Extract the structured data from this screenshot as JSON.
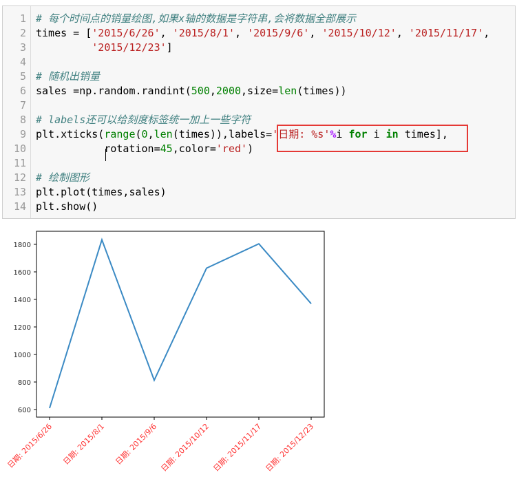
{
  "notebook": {
    "lines": [
      {
        "n": "1",
        "tokens": [
          {
            "t": "# 每个时间点的销量绘图,如果x轴的数据是字符串,会将数据全部展示",
            "c": "comment"
          }
        ]
      },
      {
        "n": "2",
        "tokens": [
          {
            "t": "times = [",
            "c": ""
          },
          {
            "t": "'2015/6/26'",
            "c": "str"
          },
          {
            "t": ", ",
            "c": ""
          },
          {
            "t": "'2015/8/1'",
            "c": "str"
          },
          {
            "t": ", ",
            "c": ""
          },
          {
            "t": "'2015/9/6'",
            "c": "str"
          },
          {
            "t": ", ",
            "c": ""
          },
          {
            "t": "'2015/10/12'",
            "c": "str"
          },
          {
            "t": ", ",
            "c": ""
          },
          {
            "t": "'2015/11/17'",
            "c": "str"
          },
          {
            "t": ",",
            "c": ""
          }
        ]
      },
      {
        "n": "3",
        "tokens": [
          {
            "t": "         ",
            "c": ""
          },
          {
            "t": "'2015/12/23'",
            "c": "str"
          },
          {
            "t": "]",
            "c": ""
          }
        ]
      },
      {
        "n": "4",
        "tokens": []
      },
      {
        "n": "5",
        "tokens": [
          {
            "t": "# 随机出销量",
            "c": "comment"
          }
        ]
      },
      {
        "n": "6",
        "tokens": [
          {
            "t": "sales =np.random.randint(",
            "c": ""
          },
          {
            "t": "500",
            "c": "num"
          },
          {
            "t": ",",
            "c": ""
          },
          {
            "t": "2000",
            "c": "num"
          },
          {
            "t": ",size=",
            "c": ""
          },
          {
            "t": "len",
            "c": "fn"
          },
          {
            "t": "(times))",
            "c": ""
          }
        ]
      },
      {
        "n": "7",
        "tokens": []
      },
      {
        "n": "8",
        "tokens": [
          {
            "t": "# labels还可以给刻度标签统一加上一些字符",
            "c": "comment"
          }
        ]
      },
      {
        "n": "9",
        "tokens": [
          {
            "t": "plt.xticks(",
            "c": ""
          },
          {
            "t": "range",
            "c": "fn"
          },
          {
            "t": "(",
            "c": ""
          },
          {
            "t": "0",
            "c": "num"
          },
          {
            "t": ",",
            "c": ""
          },
          {
            "t": "len",
            "c": "fn"
          },
          {
            "t": "(times)),labels=",
            "c": ""
          },
          {
            "t": "'日期: %s'",
            "c": "str"
          },
          {
            "t": "%",
            "c": "op"
          },
          {
            "t": "i ",
            "c": ""
          },
          {
            "t": "for",
            "c": "kw"
          },
          {
            "t": " i ",
            "c": ""
          },
          {
            "t": "in",
            "c": "kw"
          },
          {
            "t": " times],",
            "c": ""
          }
        ]
      },
      {
        "n": "10",
        "tokens": [
          {
            "t": "           rotation=",
            "c": ""
          },
          {
            "t": "45",
            "c": "num"
          },
          {
            "t": ",color=",
            "c": ""
          },
          {
            "t": "'red'",
            "c": "str"
          },
          {
            "t": ")",
            "c": ""
          }
        ]
      },
      {
        "n": "11",
        "tokens": []
      },
      {
        "n": "12",
        "tokens": [
          {
            "t": "# 绘制图形",
            "c": "comment"
          }
        ]
      },
      {
        "n": "13",
        "tokens": [
          {
            "t": "plt.plot(times,sales)",
            "c": ""
          }
        ]
      },
      {
        "n": "14",
        "tokens": [
          {
            "t": "plt.show()",
            "c": ""
          }
        ]
      }
    ]
  },
  "chart_data": {
    "type": "line",
    "categories": [
      "日期: 2015/6/26",
      "日期: 2015/8/1",
      "日期: 2015/9/6",
      "日期: 2015/10/12",
      "日期: 2015/11/17",
      "日期: 2015/12/23"
    ],
    "series": [
      {
        "values": [
          610,
          1833,
          813,
          1627,
          1804,
          1369
        ],
        "color": "#3b8ac4"
      }
    ],
    "yticks": [
      600,
      800,
      1000,
      1200,
      1400,
      1600,
      1800
    ],
    "ylim": [
      545,
      1895
    ],
    "tick_label_color": "#ff3333",
    "tick_label_rotation": "45 degrees"
  }
}
